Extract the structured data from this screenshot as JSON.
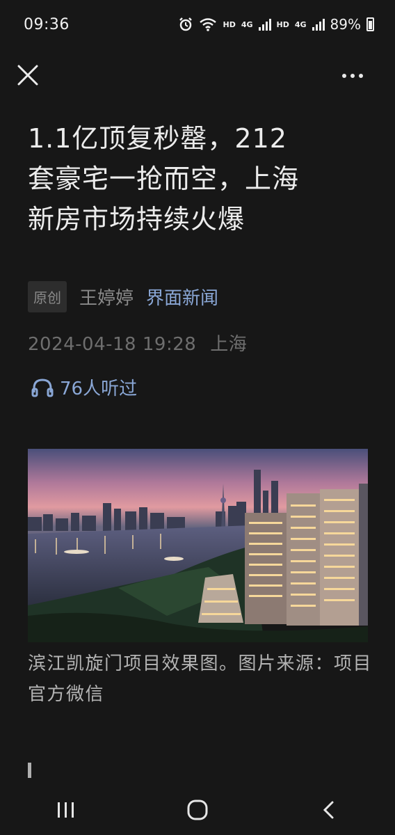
{
  "status_bar": {
    "time": "09:36",
    "hd1": "HD",
    "net1": "4G",
    "hd2": "HD",
    "net2": "4G",
    "battery": "89%"
  },
  "article": {
    "title_lines": [
      "1.1亿顶复秒罄，212",
      "套豪宅一抢而空，上海",
      "新房市场持续火爆"
    ],
    "badge": "原创",
    "author": "王婷婷",
    "source": "界面新闻",
    "date": "2024-04-18 19:28",
    "location": "上海",
    "listen_count": "76人听过",
    "caption": "滨江凯旋门项目效果图。图片来源：项目官方微信"
  },
  "icons": {
    "close": "close-icon",
    "more": "more-icon",
    "headphones": "headphones-icon",
    "nav_recent": "recent-apps-icon",
    "nav_home": "home-icon",
    "nav_back": "back-icon"
  }
}
